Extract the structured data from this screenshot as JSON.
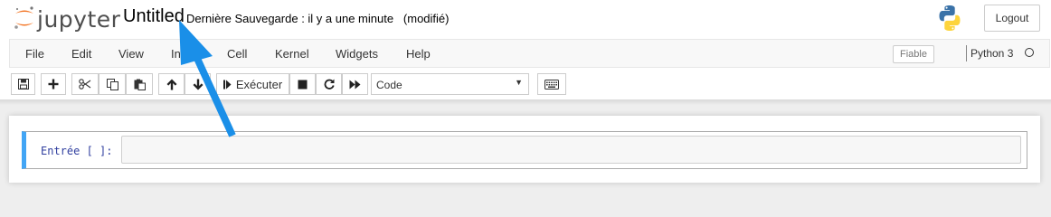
{
  "app": {
    "logo_text": "jupyter",
    "notebook_title": "Untitled",
    "save_status": "Dernière Sauvegarde : il y a une minute   (modifié)",
    "logout_label": "Logout"
  },
  "menu": {
    "items": [
      "File",
      "Edit",
      "View",
      "Insert",
      "Cell",
      "Kernel",
      "Widgets",
      "Help"
    ],
    "trusted_label": "Fiable",
    "kernel_name": "Python 3"
  },
  "toolbar": {
    "run_label": "Exécuter",
    "cell_type_value": "Code",
    "icons": [
      "save-icon",
      "plus-icon",
      "cut-icon",
      "copy-icon",
      "paste-icon",
      "arrow-up-icon",
      "arrow-down-icon",
      "step-forward-icon",
      "stop-icon",
      "restart-icon",
      "fast-forward-icon",
      "keyboard-icon"
    ]
  },
  "cell": {
    "prompt": "Entrée [ ]:",
    "content": ""
  },
  "colors": {
    "accent_arrow": "#1a8fe8",
    "cell_selected_border": "#42a5f5",
    "jupyter_orange": "#f37626"
  }
}
